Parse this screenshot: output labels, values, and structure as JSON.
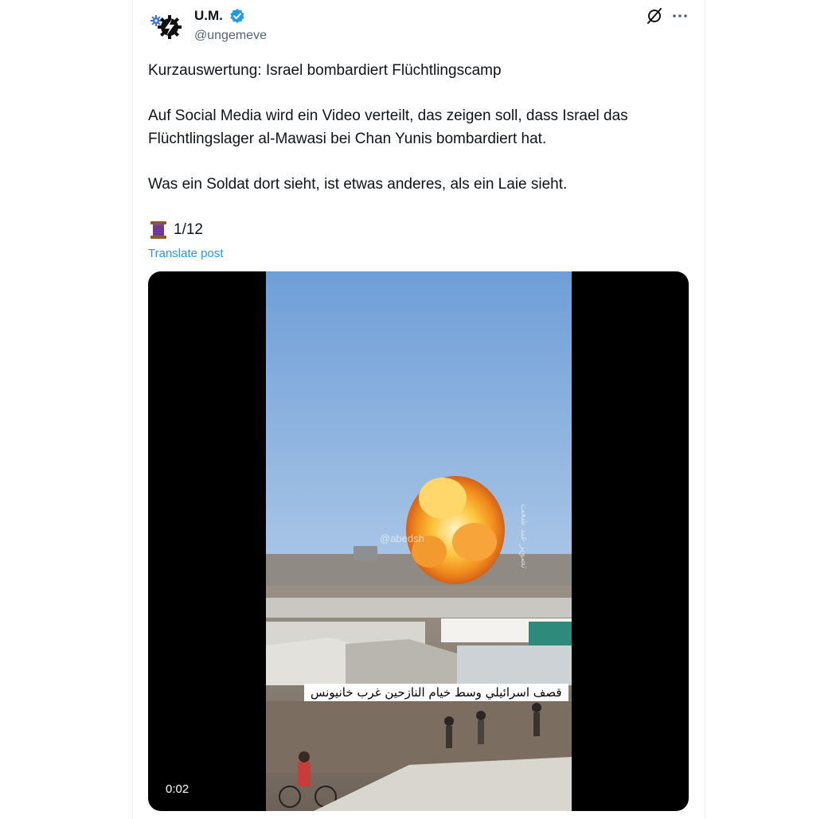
{
  "author": {
    "display_name": "U.M.",
    "handle": "@ungemeve"
  },
  "post": {
    "paragraphs": [
      "Kurzauswertung: Israel bombardiert Flüchtlingscamp",
      "Auf Social Media wird ein Video verteilt, das zeigen soll, dass Israel das Flüchtlingslager al-Mawasi bei Chan Yunis bombardiert hat.",
      "Was ein Soldat dort sieht, ist etwas anderes, als ein Laie sieht."
    ],
    "thread_counter": "1/12",
    "translate_label": "Translate post"
  },
  "media": {
    "duration": "0:02",
    "caption": "قصف اسرائيلي وسط خيام النازحين غرب خانيونس",
    "watermark": "@abedsh",
    "side_watermark": "تصوير عبد شعت"
  },
  "colors": {
    "link": "#1d9bf0",
    "verified": "#1d9bf0",
    "secondary_text": "#536471"
  },
  "icons": {
    "avatar": "gear-lightning-logo",
    "verified": "verified-badge-icon",
    "grok": "grok-icon",
    "more": "more-icon",
    "thread": "spool-of-thread-emoji"
  }
}
